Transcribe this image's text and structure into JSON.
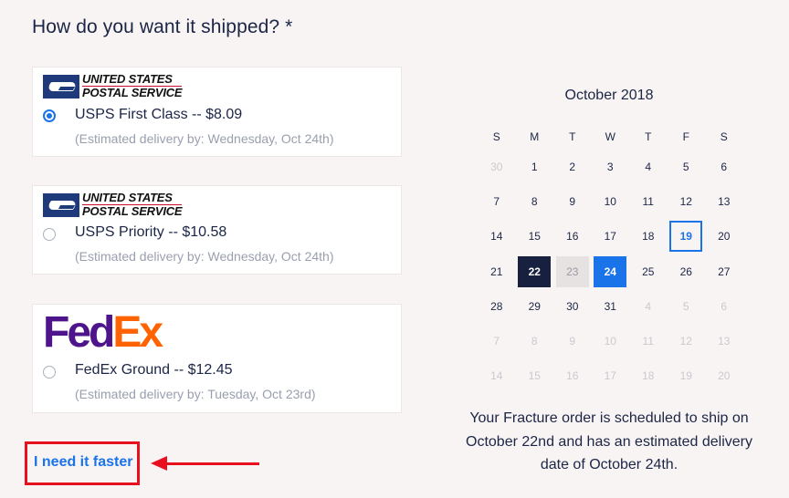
{
  "heading": "How do you want it shipped? *",
  "options": [
    {
      "carrier_logo": "usps-logo",
      "logo_line1": "UNITED STATES",
      "logo_line2": "POSTAL SERVICE",
      "label": "USPS First Class -- $8.09",
      "estimate": "(Estimated delivery by: Wednesday, Oct 24th)",
      "selected": true
    },
    {
      "carrier_logo": "usps-logo",
      "logo_line1": "UNITED STATES",
      "logo_line2": "POSTAL SERVICE",
      "label": "USPS Priority -- $10.58",
      "estimate": "(Estimated delivery by: Wednesday, Oct 24th)",
      "selected": false
    },
    {
      "carrier_logo": "fedex-logo",
      "logo_fed": "Fed",
      "logo_ex": "Ex",
      "label": "FedEx Ground -- $12.45",
      "estimate": "(Estimated delivery by: Tuesday, Oct 23rd)",
      "selected": false
    }
  ],
  "faster_link": "I need it faster",
  "calendar": {
    "month": "October 2018",
    "days_of_week": [
      "S",
      "M",
      "T",
      "W",
      "T",
      "F",
      "S"
    ],
    "weeks": [
      [
        {
          "d": "30",
          "s": "muted"
        },
        {
          "d": "1",
          "s": ""
        },
        {
          "d": "2",
          "s": ""
        },
        {
          "d": "3",
          "s": ""
        },
        {
          "d": "4",
          "s": ""
        },
        {
          "d": "5",
          "s": ""
        },
        {
          "d": "6",
          "s": ""
        }
      ],
      [
        {
          "d": "7",
          "s": ""
        },
        {
          "d": "8",
          "s": ""
        },
        {
          "d": "9",
          "s": ""
        },
        {
          "d": "10",
          "s": ""
        },
        {
          "d": "11",
          "s": ""
        },
        {
          "d": "12",
          "s": ""
        },
        {
          "d": "13",
          "s": ""
        }
      ],
      [
        {
          "d": "14",
          "s": ""
        },
        {
          "d": "15",
          "s": ""
        },
        {
          "d": "16",
          "s": ""
        },
        {
          "d": "17",
          "s": ""
        },
        {
          "d": "18",
          "s": ""
        },
        {
          "d": "19",
          "s": "today"
        },
        {
          "d": "20",
          "s": ""
        }
      ],
      [
        {
          "d": "21",
          "s": ""
        },
        {
          "d": "22",
          "s": "ship"
        },
        {
          "d": "23",
          "s": "transit"
        },
        {
          "d": "24",
          "s": "deliver"
        },
        {
          "d": "25",
          "s": ""
        },
        {
          "d": "26",
          "s": ""
        },
        {
          "d": "27",
          "s": ""
        }
      ],
      [
        {
          "d": "28",
          "s": ""
        },
        {
          "d": "29",
          "s": ""
        },
        {
          "d": "30",
          "s": ""
        },
        {
          "d": "31",
          "s": ""
        },
        {
          "d": "4",
          "s": "muted"
        },
        {
          "d": "5",
          "s": "muted"
        },
        {
          "d": "6",
          "s": "muted"
        }
      ],
      [
        {
          "d": "7",
          "s": "muted"
        },
        {
          "d": "8",
          "s": "muted"
        },
        {
          "d": "9",
          "s": "muted"
        },
        {
          "d": "10",
          "s": "muted"
        },
        {
          "d": "11",
          "s": "muted"
        },
        {
          "d": "12",
          "s": "muted"
        },
        {
          "d": "13",
          "s": "muted"
        }
      ],
      [
        {
          "d": "14",
          "s": "muted"
        },
        {
          "d": "15",
          "s": "muted"
        },
        {
          "d": "16",
          "s": "muted"
        },
        {
          "d": "17",
          "s": "muted"
        },
        {
          "d": "18",
          "s": "muted"
        },
        {
          "d": "19",
          "s": "muted"
        },
        {
          "d": "20",
          "s": "muted"
        }
      ]
    ]
  },
  "summary": "Your Fracture order is scheduled to ship on October 22nd and has an estimated delivery date of October 24th.",
  "colors": {
    "accent": "#1a73e8",
    "ship_day": "#17213f",
    "annotation": "#e8101e"
  }
}
